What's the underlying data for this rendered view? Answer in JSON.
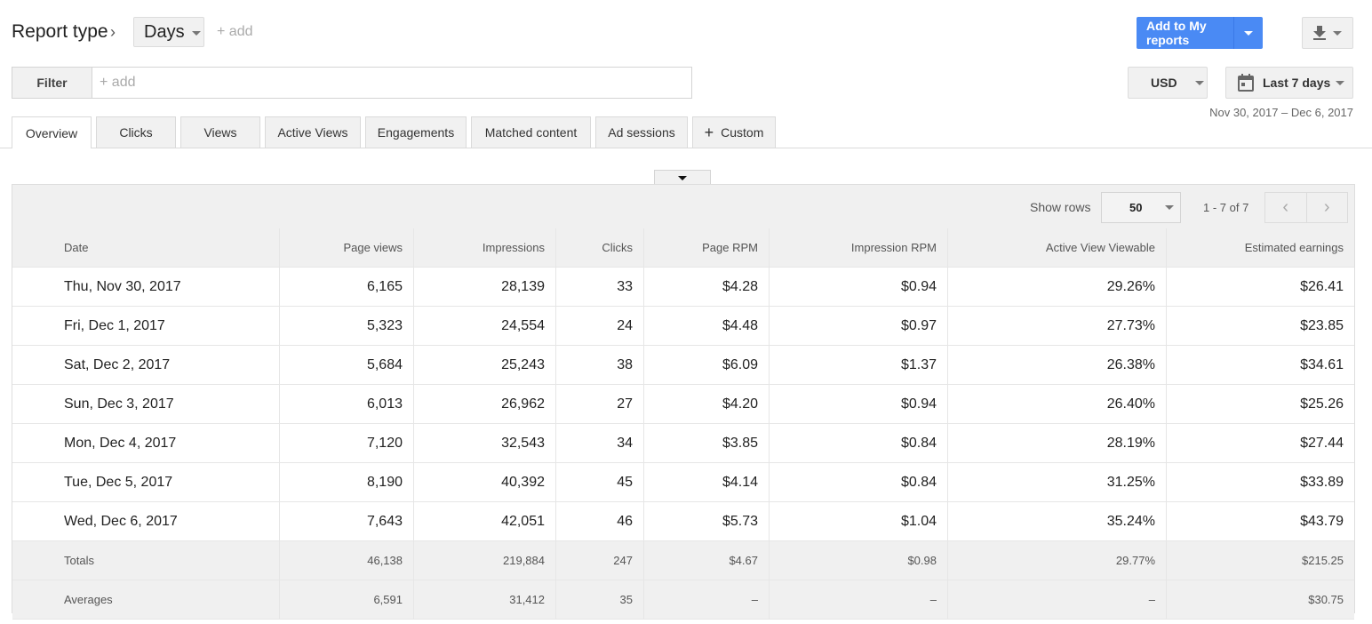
{
  "header": {
    "report_type_label": "Report type",
    "breadcrumb_separator": "›",
    "dimension": "Days",
    "add_dimension": "+ add"
  },
  "filter": {
    "label": "Filter",
    "placeholder": "+ add"
  },
  "actions": {
    "add_to_reports": "Add to My reports",
    "download_icon": "download-icon",
    "currency": "USD",
    "date_preset": "Last 7 days",
    "date_range": "Nov 30, 2017 – Dec 6, 2017",
    "accent_color": "#4a8af4"
  },
  "tabs": [
    {
      "label": "Overview",
      "active": true
    },
    {
      "label": "Clicks"
    },
    {
      "label": "Views"
    },
    {
      "label": "Active Views"
    },
    {
      "label": "Engagements"
    },
    {
      "label": "Matched content"
    },
    {
      "label": "Ad sessions"
    },
    {
      "label": "Custom",
      "icon": "plus-icon"
    }
  ],
  "table": {
    "show_rows_label": "Show rows",
    "rows_per_page": "50",
    "page_info": "1 - 7 of 7",
    "columns": [
      "Date",
      "Page views",
      "Impressions",
      "Clicks",
      "Page RPM",
      "Impression RPM",
      "Active View Viewable",
      "Estimated earnings"
    ],
    "rows": [
      [
        "Thu, Nov 30, 2017",
        "6,165",
        "28,139",
        "33",
        "$4.28",
        "$0.94",
        "29.26%",
        "$26.41"
      ],
      [
        "Fri, Dec 1, 2017",
        "5,323",
        "24,554",
        "24",
        "$4.48",
        "$0.97",
        "27.73%",
        "$23.85"
      ],
      [
        "Sat, Dec 2, 2017",
        "5,684",
        "25,243",
        "38",
        "$6.09",
        "$1.37",
        "26.38%",
        "$34.61"
      ],
      [
        "Sun, Dec 3, 2017",
        "6,013",
        "26,962",
        "27",
        "$4.20",
        "$0.94",
        "26.40%",
        "$25.26"
      ],
      [
        "Mon, Dec 4, 2017",
        "7,120",
        "32,543",
        "34",
        "$3.85",
        "$0.84",
        "28.19%",
        "$27.44"
      ],
      [
        "Tue, Dec 5, 2017",
        "8,190",
        "40,392",
        "45",
        "$4.14",
        "$0.84",
        "31.25%",
        "$33.89"
      ],
      [
        "Wed, Dec 6, 2017",
        "7,643",
        "42,051",
        "46",
        "$5.73",
        "$1.04",
        "35.24%",
        "$43.79"
      ]
    ],
    "totals": [
      "Totals",
      "46,138",
      "219,884",
      "247",
      "$4.67",
      "$0.98",
      "29.77%",
      "$215.25"
    ],
    "averages": [
      "Averages",
      "6,591",
      "31,412",
      "35",
      "–",
      "–",
      "–",
      "$30.75"
    ]
  }
}
